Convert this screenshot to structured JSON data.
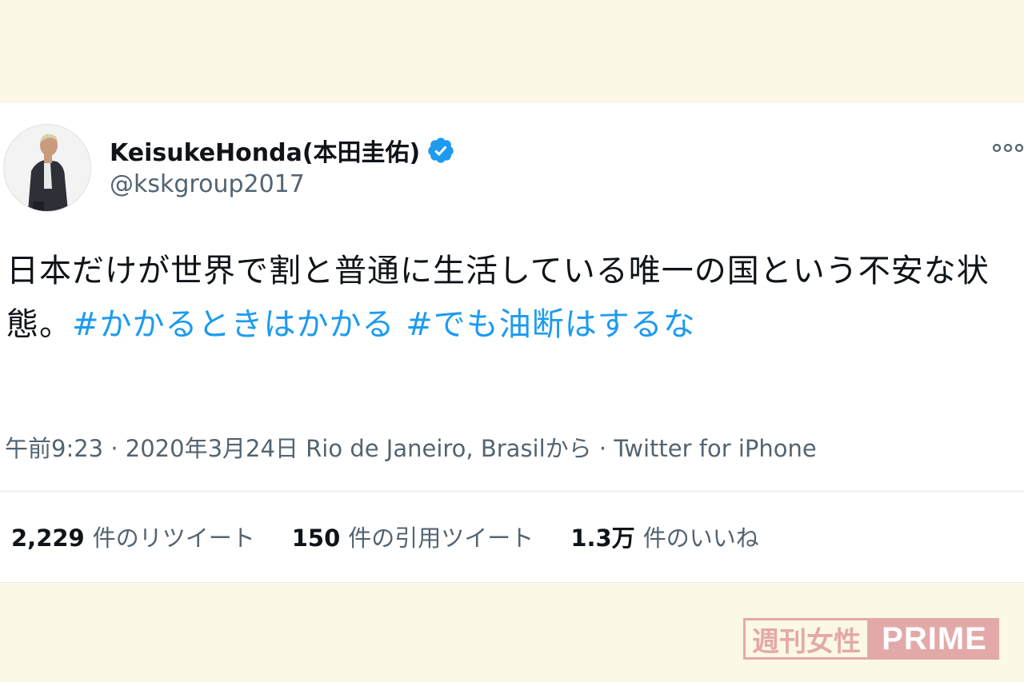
{
  "tweet": {
    "display_name": "KeisukeHonda(本田圭佑)",
    "username": "@kskgroup2017",
    "verified_icon": "verified-badge-icon",
    "more_icon": "more-options-icon",
    "text_plain": "日本だけが世界で割と普通に生活している唯一の国という不安な状態。",
    "hashtag_1": "#かかるときはかかる",
    "hashtag_2": "#でも油断はするな",
    "time": "午前9:23",
    "separator": "·",
    "date": "2020年3月24日",
    "location": "Rio de Janeiro, Brasilから",
    "source": "Twitter for iPhone"
  },
  "stats": {
    "retweets_count": "2,229",
    "retweets_label": "件のリツイート",
    "quotes_count": "150",
    "quotes_label": "件の引用ツイート",
    "likes_count": "1.3万",
    "likes_label": "件のいいね"
  },
  "watermark": {
    "jp": "週刊女性",
    "en": "PRIME"
  },
  "colors": {
    "background": "#fcf8e6",
    "hashtag": "#1d9bf0",
    "verified": "#1d9bf0",
    "secondary_text": "#536471",
    "watermark": "#e3a9a9"
  }
}
